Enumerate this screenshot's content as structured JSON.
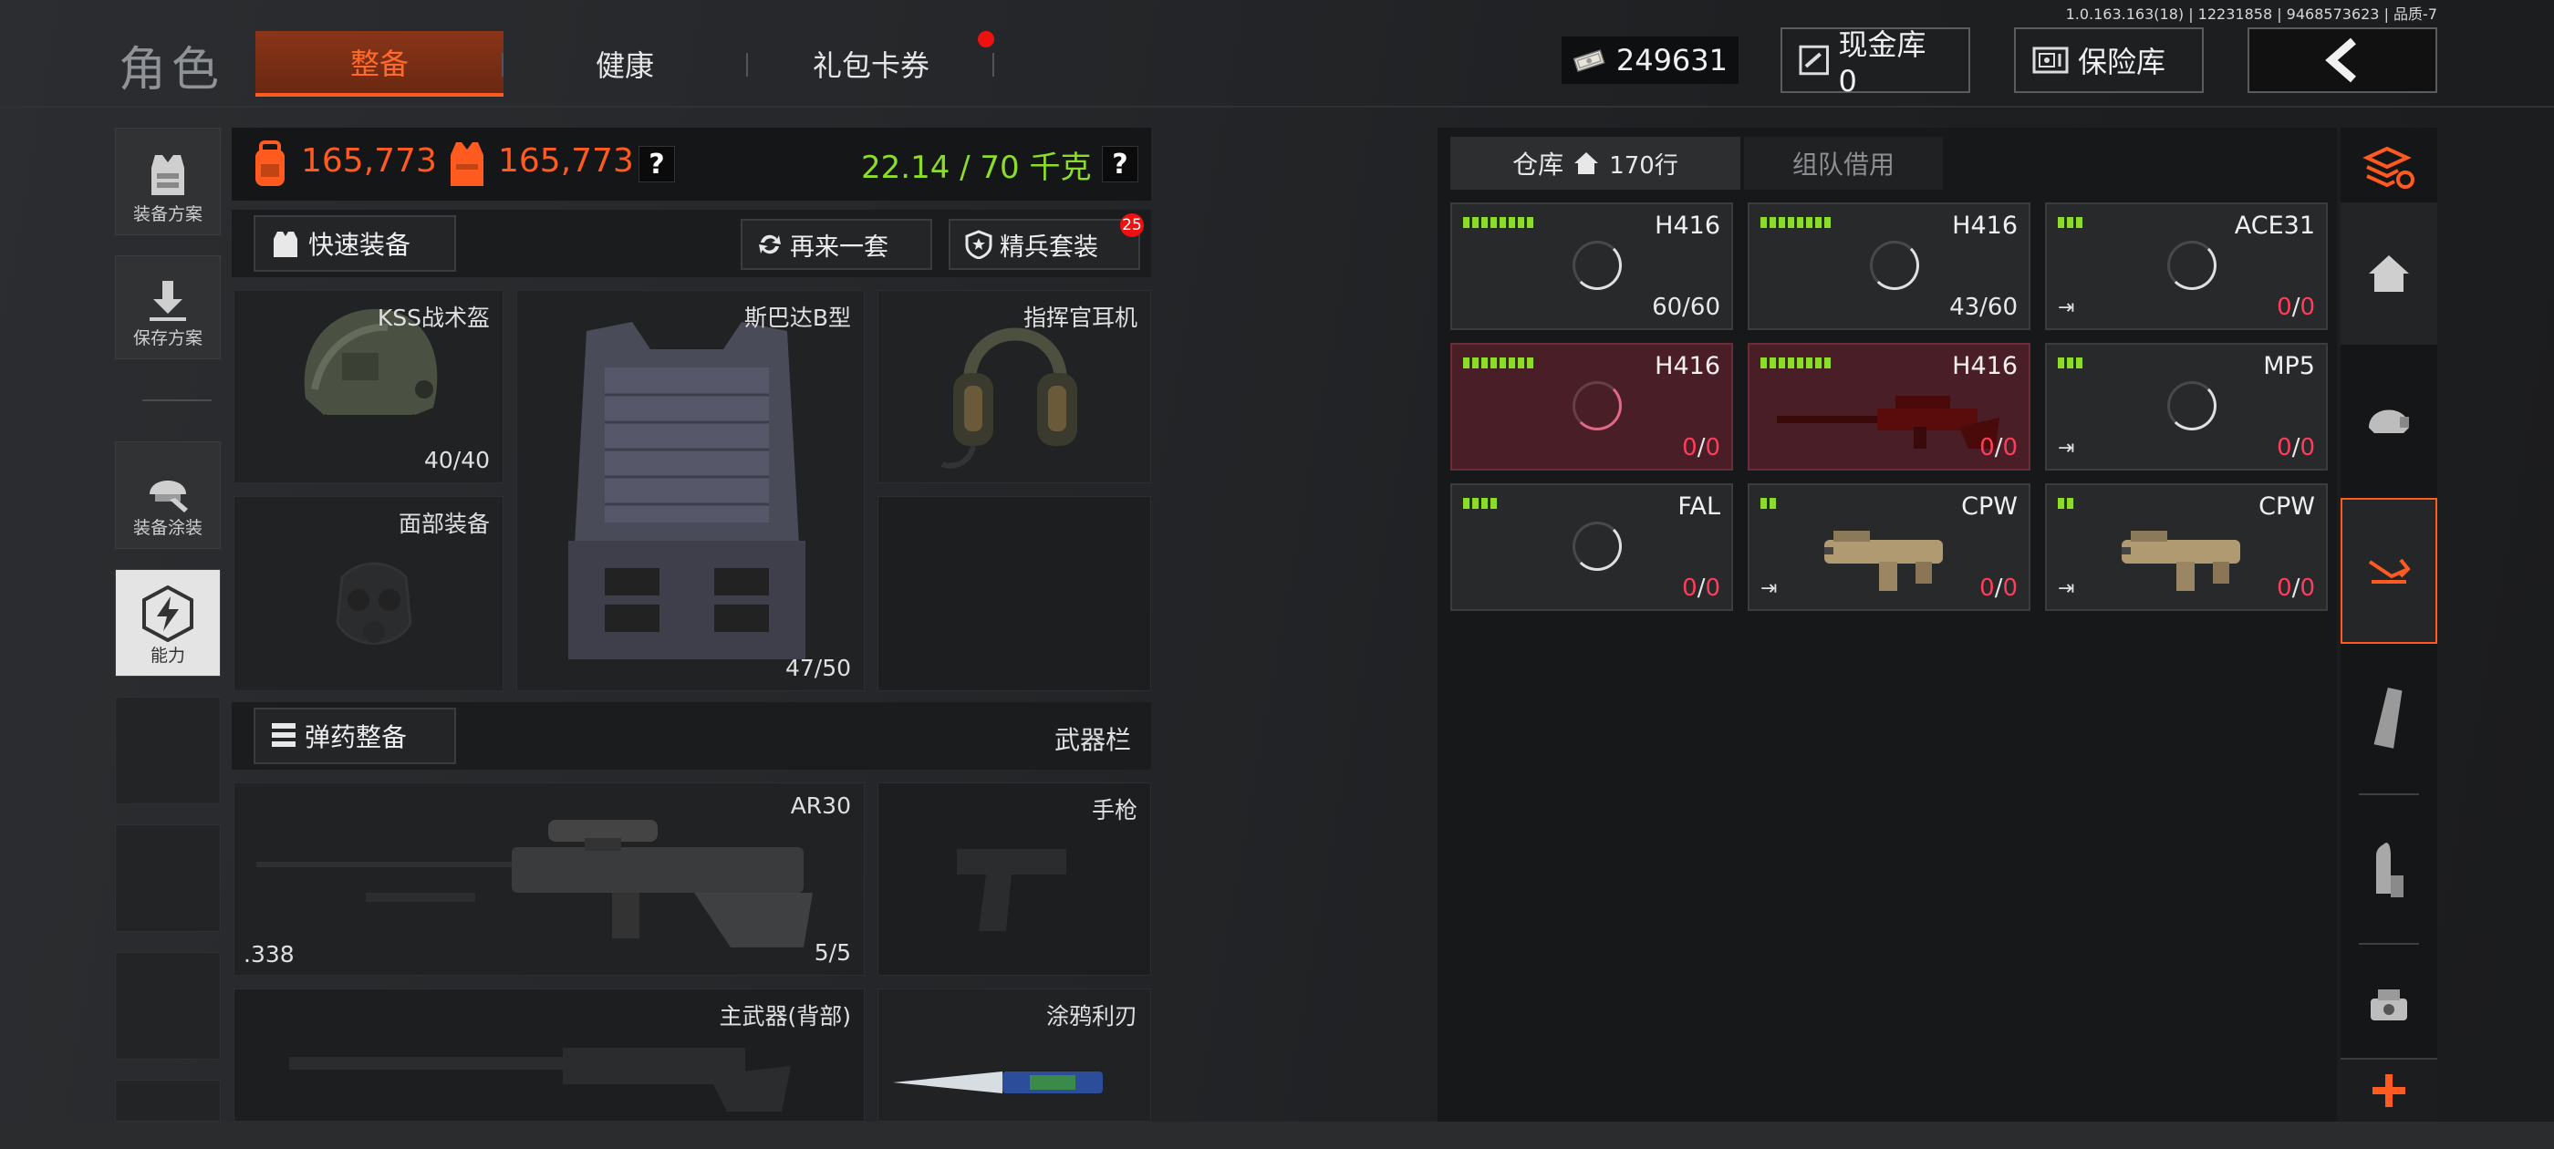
{
  "version_text": "1.0.163.163(18) | 12231858 | 9468573623 | 品质-7",
  "title": "角色",
  "tabs": [
    {
      "label": "整备",
      "active": true
    },
    {
      "label": "健康",
      "active": false
    },
    {
      "label": "礼包卡券",
      "active": false
    }
  ],
  "top": {
    "money": "249631",
    "cash_vault": "现金库 0",
    "safe": "保险库"
  },
  "left_sidebar": [
    {
      "label": "装备方案"
    },
    {
      "label": "保存方案"
    },
    {
      "label": "装备涂装"
    },
    {
      "label": "能力"
    }
  ],
  "stats": {
    "value1": "165,773",
    "value2": "165,773",
    "weight": "22.14 / 70 千克",
    "help": "?"
  },
  "actions": {
    "quick_equip": "快速装备",
    "again": "再来一套",
    "elite": "精兵套装",
    "elite_badge": "25"
  },
  "gear": {
    "helmet": {
      "label": "KSS战术盔",
      "value": "40/40"
    },
    "armor": {
      "label": "斯巴达B型",
      "value": "47/50"
    },
    "headset": {
      "label": "指挥官耳机"
    },
    "face": {
      "label": "面部装备"
    }
  },
  "ammo": {
    "button": "弹药整备",
    "weapon_bar": "武器栏"
  },
  "weapons": {
    "primary": {
      "label": "AR30",
      "caliber": ".338",
      "ammo": "5/5"
    },
    "pistol": {
      "label": "手枪"
    },
    "back": {
      "label": "主武器(背部)"
    },
    "melee": {
      "label": "涂鸦利刃"
    }
  },
  "warehouse": {
    "tab_label": "仓库",
    "rows": "170行",
    "team_tab": "组队借用"
  },
  "items": [
    {
      "name": "H416",
      "dur": "60/60",
      "bars": 8,
      "red": false,
      "depleted": false,
      "exit": false,
      "img": "spinner"
    },
    {
      "name": "H416",
      "dur": "43/60",
      "bars": 8,
      "red": false,
      "depleted": false,
      "exit": false,
      "img": "spinner"
    },
    {
      "name": "ACE31",
      "dur": "0/0",
      "bars": 3,
      "red": false,
      "depleted": true,
      "exit": true,
      "img": "spinner"
    },
    {
      "name": "H416",
      "dur": "0/0",
      "bars": 8,
      "red": true,
      "depleted": true,
      "exit": false,
      "img": "spinner"
    },
    {
      "name": "H416",
      "dur": "0/0",
      "bars": 8,
      "red": true,
      "depleted": true,
      "exit": false,
      "img": "rifle"
    },
    {
      "name": "MP5",
      "dur": "0/0",
      "bars": 3,
      "red": false,
      "depleted": true,
      "exit": true,
      "img": "spinner"
    },
    {
      "name": "FAL",
      "dur": "0/0",
      "bars": 4,
      "red": false,
      "depleted": true,
      "exit": false,
      "img": "spinner"
    },
    {
      "name": "CPW",
      "dur": "0/0",
      "bars": 2,
      "red": false,
      "depleted": true,
      "exit": true,
      "img": "smg"
    },
    {
      "name": "CPW",
      "dur": "0/0",
      "bars": 2,
      "red": false,
      "depleted": true,
      "exit": true,
      "img": "smg"
    }
  ],
  "right_sidebar_icons": [
    "stack-refresh-icon",
    "home-icon",
    "helmet-icon",
    "weapon-mod-icon",
    "magazine-icon",
    "bullet-icon",
    "scope-icon",
    "plus-icon"
  ],
  "colors": {
    "accent": "#ff5a1f",
    "green": "#8edc2a",
    "red": "#ff3d5a"
  }
}
